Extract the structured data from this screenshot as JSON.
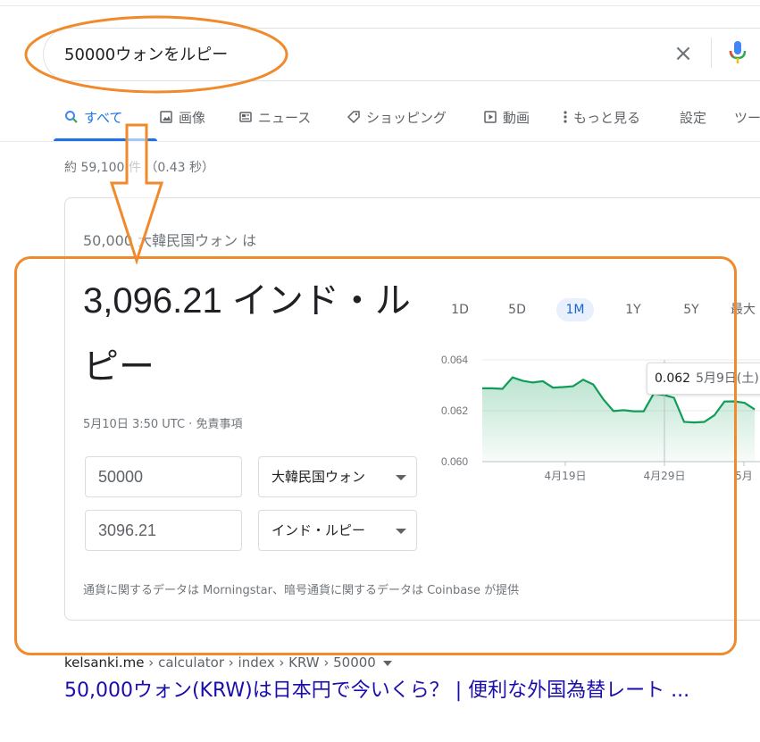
{
  "search": {
    "query": "50000ウォンをルピー",
    "clear_label": "×"
  },
  "tabs": [
    {
      "label": "すべて",
      "icon": "search-icon",
      "active": true
    },
    {
      "label": "画像",
      "icon": "image-icon"
    },
    {
      "label": "ニュース",
      "icon": "news-icon"
    },
    {
      "label": "ショッピング",
      "icon": "tag-icon"
    },
    {
      "label": "動画",
      "icon": "play-icon"
    },
    {
      "label": "もっと見る",
      "icon": "more-vert-icon"
    },
    {
      "label": "設定"
    },
    {
      "label": "ツー"
    }
  ],
  "stats": "約 59,100 件  （0.43 秒）",
  "converter": {
    "from_line": "50,000 大韓民国ウォン は",
    "result": "3,096.21 インド・ルピー",
    "timestamp": "5月10日 3:50 UTC · 免責事項",
    "amount_from": "50000",
    "currency_from": "大韓民国ウォン",
    "amount_to": "3096.21",
    "currency_to": "インド・ルピー",
    "source": "通貨に関するデータは Morningstar、暗号通貨に関するデータは Coinbase が提供"
  },
  "ranges": [
    {
      "label": "1D"
    },
    {
      "label": "5D"
    },
    {
      "label": "1M",
      "active": true
    },
    {
      "label": "1Y"
    },
    {
      "label": "5Y"
    },
    {
      "label": "最大"
    }
  ],
  "chart_data": {
    "type": "area",
    "x_tick_labels": [
      "4月19日",
      "4月29日",
      "5月"
    ],
    "y_tick_labels": [
      "0.064",
      "0.062",
      "0.060"
    ],
    "ylim": [
      0.06,
      0.064
    ],
    "values": [
      0.06288,
      0.06288,
      0.06286,
      0.06331,
      0.06318,
      0.06311,
      0.06316,
      0.06291,
      0.06293,
      0.06296,
      0.06322,
      0.06303,
      0.06245,
      0.06199,
      0.06202,
      0.06198,
      0.06198,
      0.06268,
      0.06262,
      0.06251,
      0.06156,
      0.06154,
      0.06156,
      0.06182,
      0.06236,
      0.06237,
      0.06231,
      0.06205
    ],
    "tooltip": {
      "value": "0.062",
      "date": "5月9日(土)"
    },
    "line_color": "#0f9d58"
  },
  "result": {
    "cite_domain": "kelsanki.me",
    "cite_path": " › calculator › index › KRW › 50000",
    "title": "50,000ウォン(KRW)は日本円で今いくら？ | 便利な外国為替レート ..."
  },
  "annotation_color": "#f08a2c"
}
